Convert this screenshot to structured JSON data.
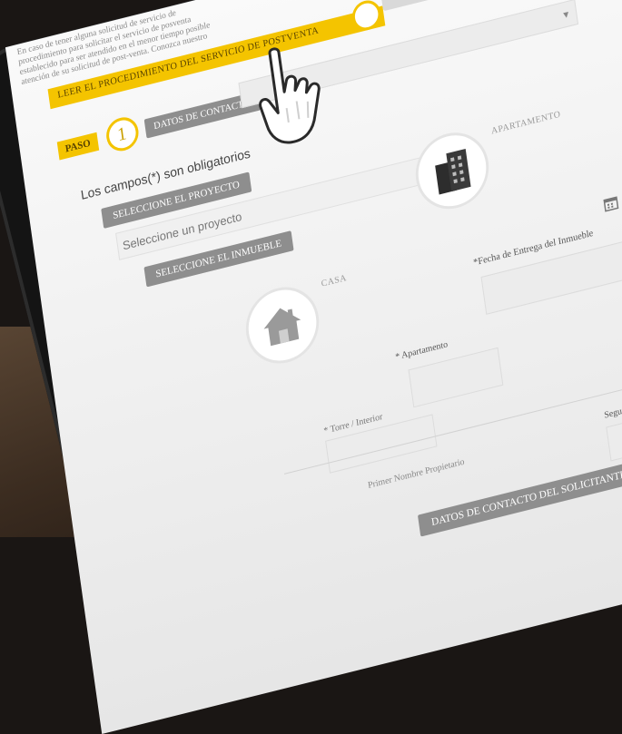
{
  "intro": {
    "lines": [
      "En caso de tener alguna solicitud de servicio de",
      "procedimiento para solicitar el servicio de posventa",
      "establecido para ser atendido en el menor tiempo posible",
      "atención de su solicitud de post-venta. Conozca nuestro"
    ]
  },
  "banner": {
    "text": "LEER EL PROCEDIMIENTO DEL SERVICIO DE POSTVENTA"
  },
  "step": {
    "paso_label": "PASO",
    "number": "1",
    "section_label": "DATOS DE CONTACTO"
  },
  "form": {
    "required_note": "Los campos(*) son obligatorios",
    "project_pill": "SELECCIONE EL PROYECTO",
    "project_placeholder": "Seleccione un proyecto",
    "property_pill": "SELECCIONE EL INMUEBLE",
    "option_apartment": "APARTAMENTO",
    "option_house": "CASA",
    "delivery_date_label": "*Fecha de Entrega del Inmueble",
    "apartment_label": "* Apartamento",
    "tower_label": "* Torre / Interior",
    "first_name_label": "Primer Nombre Propietario",
    "contact_pill": "DATOS DE CONTACTO DEL SOLICITANTE",
    "second_name_label": "Segundo Nombre"
  },
  "colors": {
    "accent_yellow": "#f4c400",
    "pill_gray": "#8e8e8e"
  },
  "icons": {
    "pointer": "hand-pointer-icon",
    "building": "building-icon",
    "house": "house-icon",
    "calendar": "calendar-icon"
  }
}
